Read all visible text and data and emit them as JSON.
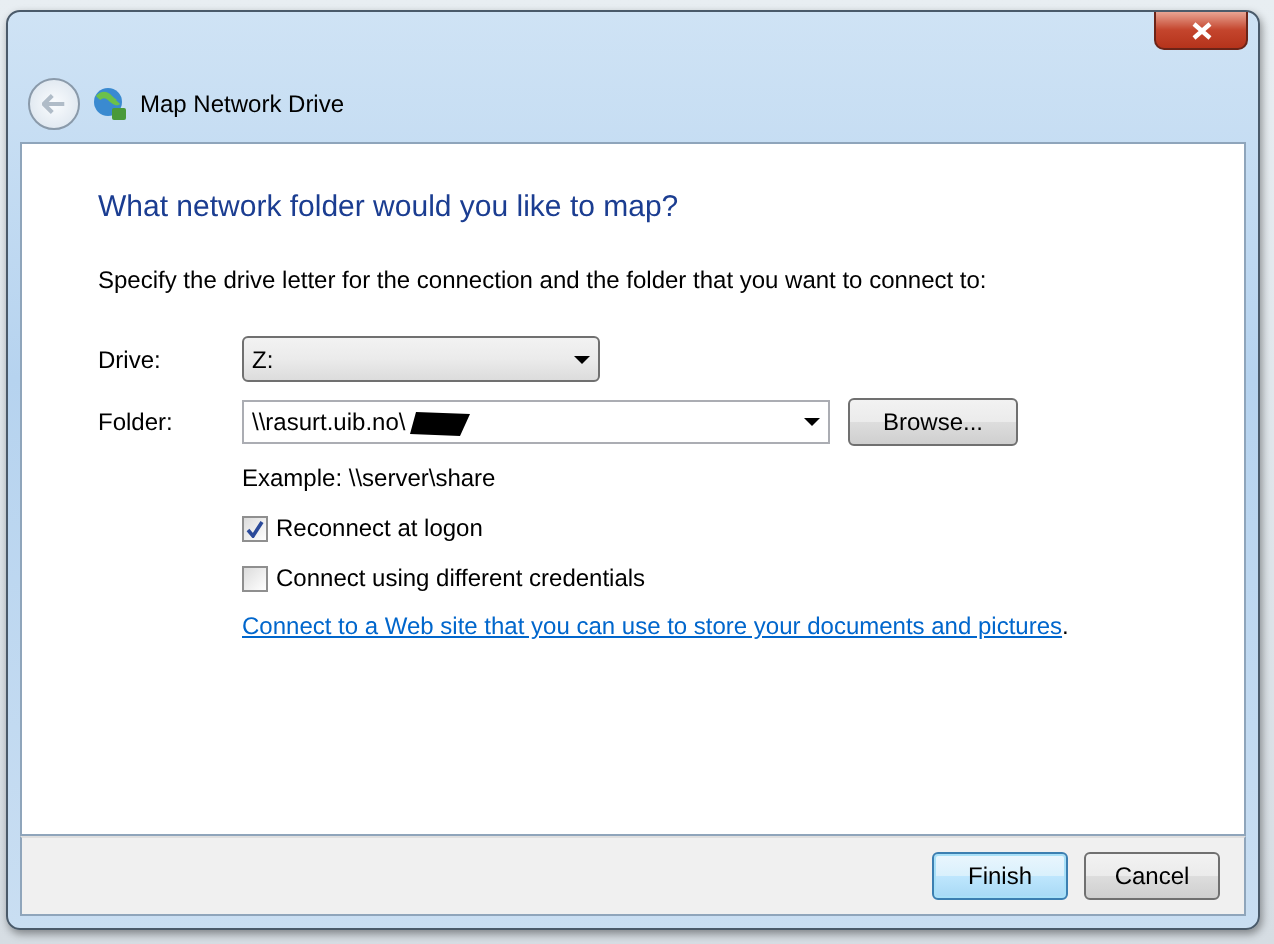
{
  "window": {
    "title": "Map Network Drive"
  },
  "heading": "What network folder would you like to map?",
  "description": "Specify the drive letter for the connection and the folder that you want to connect to:",
  "drive": {
    "label": "Drive:",
    "value": "Z:"
  },
  "folder": {
    "label": "Folder:",
    "value": "\\\\rasurt.uib.no\\",
    "redacted": true,
    "browse": "Browse..."
  },
  "example": "Example: \\\\server\\share",
  "options": [
    {
      "label": "Reconnect at logon",
      "checked": true
    },
    {
      "label": "Connect using different credentials",
      "checked": false
    }
  ],
  "link": "Connect to a Web site that you can use to store your documents and pictures",
  "link_suffix": ".",
  "buttons": [
    {
      "label": "Finish",
      "default": true
    },
    {
      "label": "Cancel",
      "default": false
    }
  ]
}
